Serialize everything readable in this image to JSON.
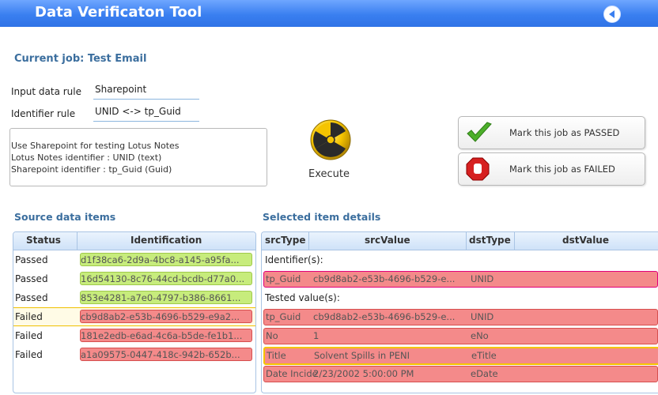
{
  "app": {
    "title": "Data Verificaton Tool"
  },
  "job": {
    "title": "Current job: Test Email"
  },
  "form": {
    "input_label": "Input data rule",
    "input_value": "Sharepoint",
    "identifier_label": "Identifier rule",
    "identifier_value": "UNID <-> tp_Guid",
    "description_lines": [
      "Use Sharepoint for testing Lotus Notes",
      "Lotus Notes identifier : UNID (text)",
      "Sharepoint  identifier : tp_Guid (Guid)"
    ]
  },
  "execute": {
    "label": "Execute"
  },
  "actions": {
    "passed_label": "Mark this job as PASSED",
    "failed_label": "Mark this job as FAILED"
  },
  "source": {
    "title": "Source data items",
    "columns": [
      "Status",
      "Identification"
    ],
    "rows": [
      {
        "status": "Passed",
        "id": "d1f38ca6-2d9a-4bc8-a145-a95fa..."
      },
      {
        "status": "Passed",
        "id": "16d54130-8c76-44cd-bcdb-d77a0..."
      },
      {
        "status": "Passed",
        "id": "853e4281-a7e0-4797-b386-8661..."
      },
      {
        "status": "Failed",
        "id": "cb9d8ab2-e53b-4696-b529-e9a2..."
      },
      {
        "status": "Failed",
        "id": "181e2edb-e6ad-4c6a-b5de-fe1b1..."
      },
      {
        "status": "Failed",
        "id": "a1a09575-0447-418c-942b-652b..."
      }
    ]
  },
  "details": {
    "title": "Selected item details",
    "columns": [
      "srcType",
      "srcValue",
      "dstType",
      "dstValue"
    ],
    "identifier_group": "Identifier(s):",
    "tested_group": "Tested value(s):",
    "identifier_row": {
      "srcType": "tp_Guid",
      "srcValue": "cb9d8ab2-e53b-4696-b529-e...",
      "dstType": "UNID",
      "dstValue": ""
    },
    "tested_rows": [
      {
        "srcType": "tp_Guid",
        "srcValue": "cb9d8ab2-e53b-4696-b529-e...",
        "dstType": "UNID",
        "dstValue": ""
      },
      {
        "srcType": "No",
        "srcValue": "1",
        "dstType": "eNo",
        "dstValue": ""
      },
      {
        "srcType": "Title",
        "srcValue": "Solvent Spills in PENI",
        "dstType": "eTitle",
        "dstValue": ""
      },
      {
        "srcType": "Date Incide",
        "srcValue": "2/23/2002 5:00:00 PM",
        "dstType": "eDate",
        "dstValue": ""
      }
    ]
  },
  "colors": {
    "titlebar": "#3a7ff0",
    "passed": "#c7ec7c",
    "failed": "#f48a8a",
    "section": "#3b6e9e"
  },
  "icons": [
    "back-arrow-icon",
    "radiation-icon",
    "check-icon",
    "stop-hand-icon"
  ]
}
